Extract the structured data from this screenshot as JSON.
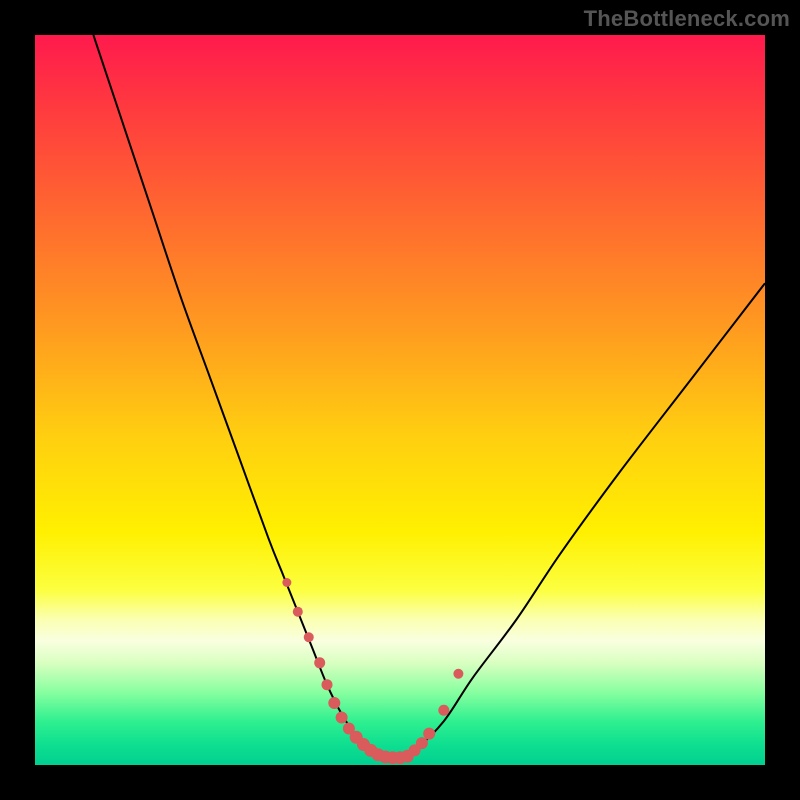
{
  "watermark": {
    "text": "TheBottleneck.com"
  },
  "chart_data": {
    "type": "line",
    "title": "",
    "xlabel": "",
    "ylabel": "",
    "xlim": [
      0,
      100
    ],
    "ylim": [
      0,
      100
    ],
    "grid": false,
    "legend": false,
    "series": [
      {
        "name": "curve",
        "x": [
          8,
          12,
          16,
          20,
          24,
          28,
          32,
          34,
          36,
          38,
          40,
          42,
          44,
          46,
          48,
          50,
          52,
          56,
          60,
          66,
          72,
          80,
          90,
          100
        ],
        "y": [
          100,
          88,
          76,
          64,
          53,
          42,
          31,
          26,
          21,
          16,
          11,
          7,
          4,
          2,
          1,
          1,
          2,
          6,
          12,
          20,
          29,
          40,
          53,
          66
        ]
      }
    ],
    "markers": {
      "name": "highlight-dots",
      "color": "#d95b5b",
      "x": [
        34.5,
        36,
        37.5,
        39,
        40,
        41,
        42,
        43,
        44,
        45,
        46,
        47,
        48,
        49,
        50,
        51,
        52,
        53,
        54,
        56,
        58
      ],
      "y": [
        25,
        21,
        17.5,
        14,
        11,
        8.5,
        6.5,
        5,
        3.8,
        2.8,
        2.0,
        1.4,
        1.1,
        1.0,
        1.0,
        1.2,
        2.0,
        3.0,
        4.3,
        7.5,
        12.5
      ],
      "r": [
        4.5,
        5,
        5,
        5.5,
        5.5,
        6,
        6,
        6,
        6.5,
        6.5,
        6.5,
        6.5,
        6.5,
        6.5,
        6.5,
        6.5,
        6,
        6,
        6,
        5.5,
        5
      ]
    }
  }
}
